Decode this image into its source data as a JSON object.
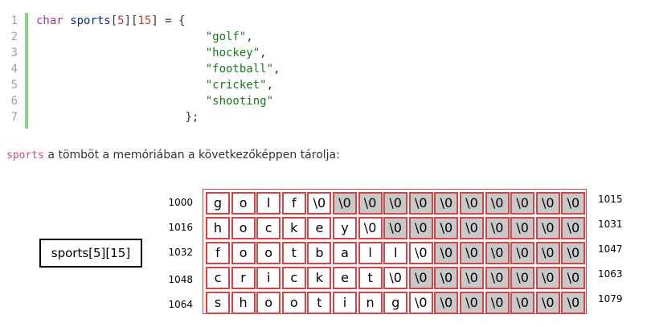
{
  "code": {
    "lines": [
      {
        "n": "1",
        "parts": [
          {
            "t": "char",
            "c": "kw"
          },
          {
            "t": " ",
            "c": "pn"
          },
          {
            "t": "sports",
            "c": "id"
          },
          {
            "t": "[",
            "c": "pn"
          },
          {
            "t": "5",
            "c": "num"
          },
          {
            "t": "][",
            "c": "pn"
          },
          {
            "t": "15",
            "c": "num"
          },
          {
            "t": "] = {",
            "c": "pn"
          }
        ]
      },
      {
        "n": "2",
        "parts": [
          {
            "t": "                         ",
            "c": "pn"
          },
          {
            "t": "\"golf\"",
            "c": "str"
          },
          {
            "t": ",",
            "c": "pn"
          }
        ]
      },
      {
        "n": "3",
        "parts": [
          {
            "t": "                         ",
            "c": "pn"
          },
          {
            "t": "\"hockey\"",
            "c": "str"
          },
          {
            "t": ",",
            "c": "pn"
          }
        ]
      },
      {
        "n": "4",
        "parts": [
          {
            "t": "                         ",
            "c": "pn"
          },
          {
            "t": "\"football\"",
            "c": "str"
          },
          {
            "t": ",",
            "c": "pn"
          }
        ]
      },
      {
        "n": "5",
        "parts": [
          {
            "t": "                         ",
            "c": "pn"
          },
          {
            "t": "\"cricket\"",
            "c": "str"
          },
          {
            "t": ",",
            "c": "pn"
          }
        ]
      },
      {
        "n": "6",
        "parts": [
          {
            "t": "                         ",
            "c": "pn"
          },
          {
            "t": "\"shooting\"",
            "c": "str"
          }
        ]
      },
      {
        "n": "7",
        "parts": [
          {
            "t": "                      ",
            "c": "pn"
          },
          {
            "t": "};",
            "c": "pn"
          }
        ]
      }
    ]
  },
  "description": {
    "code_term": "sports",
    "text": " a tömböt a memóriában a következőképpen tárolja:"
  },
  "diagram": {
    "label": "sports[5][15]",
    "rows": [
      {
        "start": "1000",
        "end": "1015",
        "cells": [
          "g",
          "o",
          "l",
          "f",
          "\\0",
          "\\0",
          "\\0",
          "\\0",
          "\\0",
          "\\0",
          "\\0",
          "\\0",
          "\\0",
          "\\0",
          "\\0"
        ]
      },
      {
        "start": "1016",
        "end": "1031",
        "cells": [
          "h",
          "o",
          "c",
          "k",
          "e",
          "y",
          "\\0",
          "\\0",
          "\\0",
          "\\0",
          "\\0",
          "\\0",
          "\\0",
          "\\0",
          "\\0"
        ]
      },
      {
        "start": "1032",
        "end": "1047",
        "cells": [
          "f",
          "o",
          "o",
          "t",
          "b",
          "a",
          "l",
          "l",
          "\\0",
          "\\0",
          "\\0",
          "\\0",
          "\\0",
          "\\0",
          "\\0"
        ]
      },
      {
        "start": "1048",
        "end": "1063",
        "cells": [
          "c",
          "r",
          "i",
          "c",
          "k",
          "e",
          "t",
          "\\0",
          "\\0",
          "\\0",
          "\\0",
          "\\0",
          "\\0",
          "\\0",
          "\\0"
        ]
      },
      {
        "start": "1064",
        "end": "1079",
        "cells": [
          "s",
          "h",
          "o",
          "o",
          "t",
          "i",
          "n",
          "g",
          "\\0",
          "\\0",
          "\\0",
          "\\0",
          "\\0",
          "\\0",
          "\\0"
        ]
      }
    ]
  }
}
